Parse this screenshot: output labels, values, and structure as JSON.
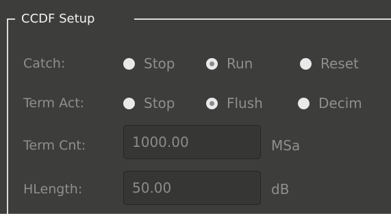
{
  "group": {
    "title": "CCDF Setup"
  },
  "catch": {
    "label": "Catch:",
    "options": [
      {
        "label": "Stop",
        "checked": false
      },
      {
        "label": "Run",
        "checked": true
      },
      {
        "label": "Reset",
        "checked": false
      }
    ]
  },
  "term_act": {
    "label": "Term Act:",
    "options": [
      {
        "label": "Stop",
        "checked": false
      },
      {
        "label": "Flush",
        "checked": true
      },
      {
        "label": "Decim",
        "checked": false
      }
    ]
  },
  "term_cnt": {
    "label": "Term Cnt:",
    "value": "1000.00",
    "unit": "MSa"
  },
  "hlength": {
    "label": "HLength:",
    "value": "50.00",
    "unit": "dB"
  },
  "colors": {
    "panel_bg": "#3d3d3b",
    "text_dim": "#8f8f8f",
    "title_text": "#f2f2f2",
    "radio_fill": "#e9e9e9"
  }
}
